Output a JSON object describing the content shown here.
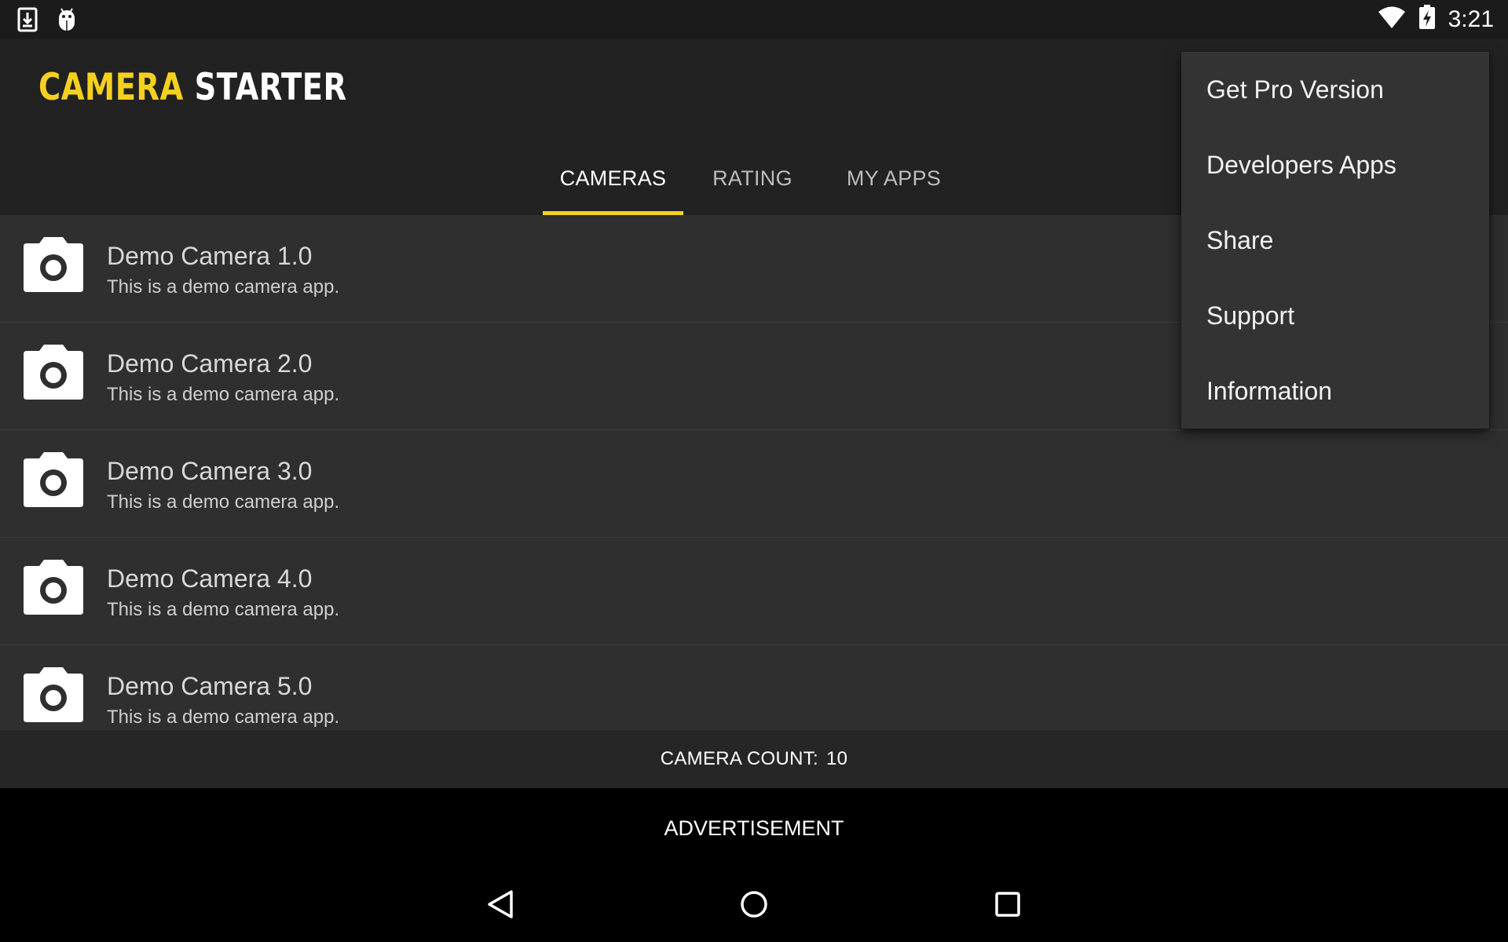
{
  "status_bar": {
    "time": "3:21",
    "left_icons": [
      "download-icon",
      "android-debug-icon"
    ],
    "right_icons": [
      "wifi-icon",
      "battery-charging-icon"
    ]
  },
  "app_bar": {
    "title_part1": "CAMERA",
    "title_part2": "STARTER",
    "accent_color": "#f4d120",
    "tabs": [
      {
        "label": "CAMERAS",
        "active": true
      },
      {
        "label": "RATING",
        "active": false
      },
      {
        "label": "MY APPS",
        "active": false
      }
    ]
  },
  "list": {
    "items": [
      {
        "title": "Demo Camera 1.0",
        "subtitle": "This is a demo camera app.",
        "icon": "camera-icon"
      },
      {
        "title": "Demo Camera 2.0",
        "subtitle": "This is a demo camera app.",
        "icon": "camera-icon"
      },
      {
        "title": "Demo Camera 3.0",
        "subtitle": "This is a demo camera app.",
        "icon": "camera-icon"
      },
      {
        "title": "Demo Camera 4.0",
        "subtitle": "This is a demo camera app.",
        "icon": "camera-icon"
      },
      {
        "title": "Demo Camera 5.0",
        "subtitle": "This is a demo camera app.",
        "icon": "camera-icon"
      }
    ]
  },
  "footer": {
    "count_label": "CAMERA COUNT:",
    "count_value": "10",
    "ad_label": "ADVERTISEMENT"
  },
  "menu": {
    "items": [
      "Get Pro Version",
      "Developers Apps",
      "Share",
      "Support",
      "Information"
    ]
  },
  "nav_bar": {
    "icons": [
      "back-icon",
      "home-icon",
      "recents-icon"
    ]
  }
}
